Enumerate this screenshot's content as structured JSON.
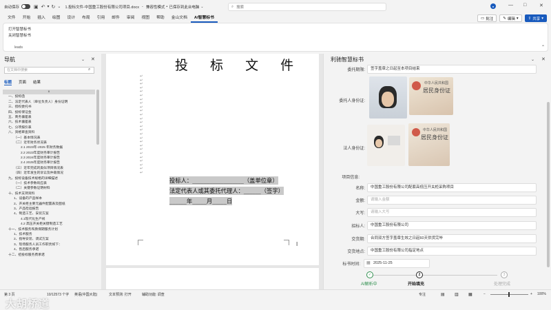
{
  "titlebar": {
    "autosave": "自动保存",
    "file_title": "1.投标文件-中国重工股份有限公司项目.docx",
    "compat": "兼容性模式",
    "saved": "已保存到此台电脑",
    "search_placeholder": "搜索"
  },
  "menu": {
    "items": [
      "文件",
      "开始",
      "插入",
      "绘图",
      "设计",
      "布局",
      "引用",
      "邮件",
      "审阅",
      "视图",
      "帮助",
      "金山文档",
      "AI智慧标书"
    ],
    "comment": "批注",
    "edit": "编辑",
    "share": "共享"
  },
  "ribbon": {
    "open": "打开智慧标书",
    "close": "关闭智慧标书",
    "group": "leads"
  },
  "nav": {
    "title": "导航",
    "search_placeholder": "在文档中搜索",
    "tabs": [
      "标题",
      "页面",
      "结果"
    ],
    "items": [
      "x",
      "一、投标函",
      "二、法定代表人（单位负责人）身份证明",
      "三、授权委托书",
      "四、投标保证金",
      "五、商务偏差表",
      "六、技术偏差表",
      "七、分项报价表",
      "八、资格审查资料",
      "（一）基本情况表",
      "（二）近年财务状况表",
      "2.1 2023年-2025 年财务数据",
      "2.2 2023年度财务审计报告",
      "2.3 2024年度财务审计报告",
      "2.4 2025年度财务审计报告",
      "（三）近年完成的类似项目情况表",
      "（四）近年发生的诉讼及仲裁情况",
      "九、投标设备技术规格的详细描述",
      "（一）技术参数响应表",
      "（二）关键参数证明材料",
      "十、技术支持资料",
      "1、设备的产品样本",
      "2、开关柜主要元器件配置表及图纸",
      "3、产品检验报告",
      "4、制造工艺、安装方案",
      "4.1现代化生产线",
      "4.2 高压开关柜关键制造工艺",
      "十一、技术服务和质保期服务计划",
      "1、技术服务",
      "2、指导安装、调试方案",
      "3、现场服务人员工作职责如下：",
      "4、售后服务承诺",
      "十二、招投标服务费承诺"
    ]
  },
  "doc": {
    "title": "投 标 文 件",
    "line1": "投标人：__________________（盖单位章）",
    "line2": "法定代表人或其委托代理人：______（签字）",
    "line3": "______年_____月_____日"
  },
  "panel": {
    "title": "利驰智慧标书",
    "fields": [
      {
        "label": "委托期限:",
        "value": "签字盖章之日起至本项目结束"
      },
      {
        "label": "委托人身份证:",
        "value": ""
      },
      {
        "label": "法人身份证:",
        "value": ""
      },
      {
        "label": "项目信息:",
        "value": ""
      },
      {
        "label": "名称:",
        "value": "中国重工股份有限公司配套高低压开关柜采购项目"
      },
      {
        "label": "金额:",
        "value": "",
        "placeholder": "请输入金额"
      },
      {
        "label": "大写:",
        "value": "",
        "placeholder": "请输入大写"
      },
      {
        "label": "招标人:",
        "value": "中国重工股份有限公司"
      },
      {
        "label": "交货期:",
        "value": "合同双方签字盖章生效之日起60天供货完毕"
      },
      {
        "label": "交货地点:",
        "value": "中国重工股份有限公司指定地点"
      },
      {
        "label": "标书时间:",
        "value": "2025-11-25"
      }
    ],
    "id_card_title": "中华人民共和国",
    "id_card_sub": "居民身份证",
    "steps": [
      "AI解析中",
      "开始填充",
      "处理完成"
    ],
    "step_nums": [
      "2",
      "3"
    ]
  },
  "statusbar": {
    "page": "第 3 页",
    "words": "10/12573 个字",
    "lang": "英语(中国大陆)",
    "predict": "文本预测: 打开",
    "access": "辅助功能: 调查",
    "focus": "专注",
    "zoom": "100%",
    "watermark": "大胡桥道"
  },
  "colors": {
    "accent": "#185abd",
    "step_done": "#2f8f4e"
  }
}
